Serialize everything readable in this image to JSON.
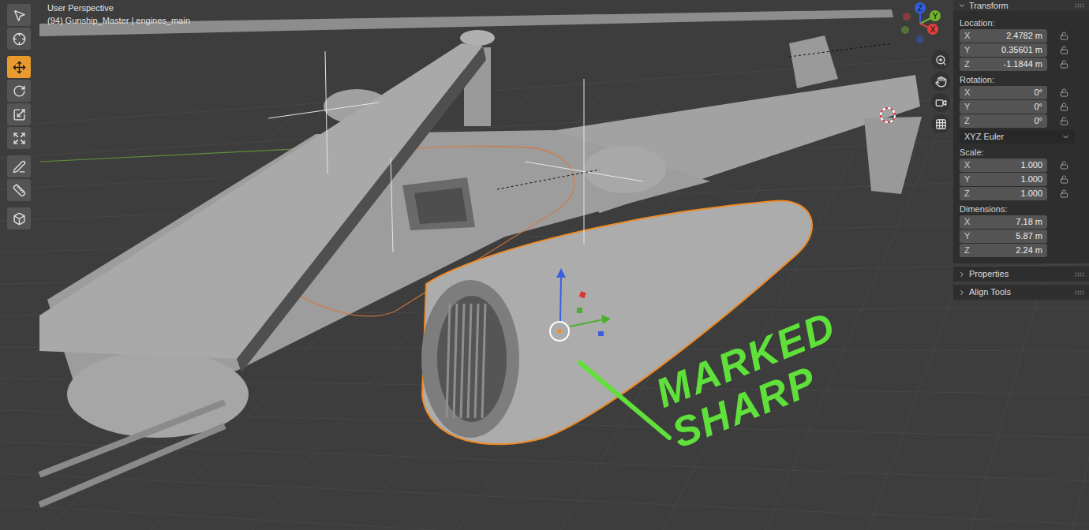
{
  "viewport": {
    "view_name": "User Perspective",
    "object_info": "(94) Gunship_Master | engines_main",
    "annotation": "MARKED SHARP"
  },
  "toolbar": {
    "groups": [
      {
        "tools": [
          {
            "kind": "select",
            "selected": false
          },
          {
            "kind": "cursor",
            "selected": false
          }
        ]
      },
      {
        "tools": [
          {
            "kind": "move",
            "selected": true
          },
          {
            "kind": "rotate",
            "selected": false
          },
          {
            "kind": "scale",
            "selected": false
          },
          {
            "kind": "transform",
            "selected": false
          }
        ]
      },
      {
        "tools": [
          {
            "kind": "annotate",
            "selected": false
          },
          {
            "kind": "measure",
            "selected": false
          }
        ]
      },
      {
        "tools": [
          {
            "kind": "add-cube",
            "selected": false
          }
        ]
      }
    ]
  },
  "navigation_gizmo": {
    "axes": [
      {
        "label": "Z",
        "color": "#2f5fe0"
      },
      {
        "label": "Y",
        "color": "#6fb52c"
      },
      {
        "label": "X",
        "color": "#e0403c"
      }
    ]
  },
  "navigation_buttons": [
    {
      "kind": "zoom"
    },
    {
      "kind": "pan"
    },
    {
      "kind": "camera"
    },
    {
      "kind": "ortho"
    }
  ],
  "sidebar": {
    "panel": {
      "title": "Transform",
      "expanded": true,
      "sections": [
        {
          "kind": "fields",
          "label": "Location:",
          "fields": [
            {
              "axis": "X",
              "value": "2.4782 m",
              "locked": false
            },
            {
              "axis": "Y",
              "value": "0.35601 m",
              "locked": false
            },
            {
              "axis": "Z",
              "value": "-1.1844 m",
              "locked": false
            }
          ]
        },
        {
          "kind": "fields",
          "label": "Rotation:",
          "fields": [
            {
              "axis": "X",
              "value": "0°",
              "locked": false
            },
            {
              "axis": "Y",
              "value": "0°",
              "locked": false
            },
            {
              "axis": "Z",
              "value": "0°",
              "locked": false
            }
          ]
        },
        {
          "kind": "dropdown",
          "value": "XYZ Euler"
        },
        {
          "kind": "fields",
          "label": "Scale:",
          "fields": [
            {
              "axis": "X",
              "value": "1.000",
              "locked": false
            },
            {
              "axis": "Y",
              "value": "1.000",
              "locked": false
            },
            {
              "axis": "Z",
              "value": "1.000",
              "locked": false
            }
          ]
        },
        {
          "kind": "fields",
          "label": "Dimensions:",
          "fields": [
            {
              "axis": "X",
              "value": "7.18 m"
            },
            {
              "axis": "Y",
              "value": "5.87 m"
            },
            {
              "axis": "Z",
              "value": "2.24 m"
            }
          ]
        }
      ]
    },
    "collapsed_panels": [
      {
        "title": "Properties",
        "expanded": false
      },
      {
        "title": "Align Tools",
        "expanded": false
      }
    ]
  }
}
